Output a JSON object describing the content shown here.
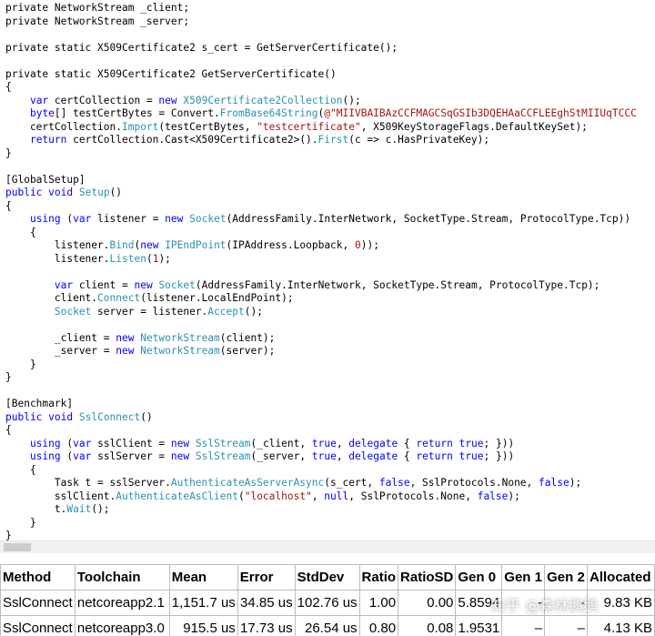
{
  "code": [
    [
      [
        "t",
        "private NetworkStream _client;"
      ]
    ],
    [
      [
        "t",
        "private NetworkStream _server;"
      ]
    ],
    [
      [
        "t",
        ""
      ]
    ],
    [
      [
        "t",
        "private static X509Certificate2 s_cert = GetServerCertificate();"
      ]
    ],
    [
      [
        "t",
        ""
      ]
    ],
    [
      [
        "t",
        "private static X509Certificate2 GetServerCertificate()"
      ]
    ],
    [
      [
        "t",
        "{"
      ]
    ],
    [
      [
        "t",
        "    "
      ],
      [
        "k",
        "var"
      ],
      [
        "t",
        " certCollection = "
      ],
      [
        "k",
        "new"
      ],
      [
        "t",
        " "
      ],
      [
        "y",
        "X509Certificate2Collection"
      ],
      [
        "t",
        "();"
      ]
    ],
    [
      [
        "t",
        "    "
      ],
      [
        "k",
        "byte"
      ],
      [
        "t",
        "[] testCertBytes = Convert."
      ],
      [
        "y",
        "FromBase64String"
      ],
      [
        "t",
        "("
      ],
      [
        "s",
        "@\"MIIVBAIBAzCCFMAGCSqGSIb3DQEHAaCCFLEEghStMIIUqTCCC"
      ]
    ],
    [
      [
        "t",
        "    certCollection."
      ],
      [
        "y",
        "Import"
      ],
      [
        "t",
        "(testCertBytes, "
      ],
      [
        "s",
        "\"testcertificate\""
      ],
      [
        "t",
        ", X509KeyStorageFlags.DefaultKeySet);"
      ]
    ],
    [
      [
        "t",
        "    "
      ],
      [
        "k",
        "return"
      ],
      [
        "t",
        " certCollection.Cast<X509Certificate2>()."
      ],
      [
        "y",
        "First"
      ],
      [
        "t",
        "(c => c.HasPrivateKey);"
      ]
    ],
    [
      [
        "t",
        "}"
      ]
    ],
    [
      [
        "t",
        ""
      ]
    ],
    [
      [
        "t",
        "[GlobalSetup]"
      ]
    ],
    [
      [
        "k",
        "public"
      ],
      [
        "t",
        " "
      ],
      [
        "k",
        "void"
      ],
      [
        "t",
        " "
      ],
      [
        "y",
        "Setup"
      ],
      [
        "t",
        "()"
      ]
    ],
    [
      [
        "t",
        "{"
      ]
    ],
    [
      [
        "t",
        "    "
      ],
      [
        "k",
        "using"
      ],
      [
        "t",
        " ("
      ],
      [
        "k",
        "var"
      ],
      [
        "t",
        " listener = "
      ],
      [
        "k",
        "new"
      ],
      [
        "t",
        " "
      ],
      [
        "y",
        "Socket"
      ],
      [
        "t",
        "(AddressFamily.InterNetwork, SocketType.Stream, ProtocolType.Tcp))"
      ]
    ],
    [
      [
        "t",
        "    {"
      ]
    ],
    [
      [
        "t",
        "        listener."
      ],
      [
        "y",
        "Bind"
      ],
      [
        "t",
        "("
      ],
      [
        "k",
        "new"
      ],
      [
        "t",
        " "
      ],
      [
        "y",
        "IPEndPoint"
      ],
      [
        "t",
        "(IPAddress.Loopback, "
      ],
      [
        "s",
        "0"
      ],
      [
        "t",
        "));"
      ]
    ],
    [
      [
        "t",
        "        listener."
      ],
      [
        "y",
        "Listen"
      ],
      [
        "t",
        "("
      ],
      [
        "s",
        "1"
      ],
      [
        "t",
        ");"
      ]
    ],
    [
      [
        "t",
        ""
      ]
    ],
    [
      [
        "t",
        "        "
      ],
      [
        "k",
        "var"
      ],
      [
        "t",
        " client = "
      ],
      [
        "k",
        "new"
      ],
      [
        "t",
        " "
      ],
      [
        "y",
        "Socket"
      ],
      [
        "t",
        "(AddressFamily.InterNetwork, SocketType.Stream, ProtocolType.Tcp);"
      ]
    ],
    [
      [
        "t",
        "        client."
      ],
      [
        "y",
        "Connect"
      ],
      [
        "t",
        "(listener.LocalEndPoint);"
      ]
    ],
    [
      [
        "t",
        "        "
      ],
      [
        "y",
        "Socket"
      ],
      [
        "t",
        " server = listener."
      ],
      [
        "y",
        "Accept"
      ],
      [
        "t",
        "();"
      ]
    ],
    [
      [
        "t",
        ""
      ]
    ],
    [
      [
        "t",
        "        _client = "
      ],
      [
        "k",
        "new"
      ],
      [
        "t",
        " "
      ],
      [
        "y",
        "NetworkStream"
      ],
      [
        "t",
        "(client);"
      ]
    ],
    [
      [
        "t",
        "        _server = "
      ],
      [
        "k",
        "new"
      ],
      [
        "t",
        " "
      ],
      [
        "y",
        "NetworkStream"
      ],
      [
        "t",
        "(server);"
      ]
    ],
    [
      [
        "t",
        "    }"
      ]
    ],
    [
      [
        "t",
        "}"
      ]
    ],
    [
      [
        "t",
        ""
      ]
    ],
    [
      [
        "t",
        "[Benchmark]"
      ]
    ],
    [
      [
        "k",
        "public"
      ],
      [
        "t",
        " "
      ],
      [
        "k",
        "void"
      ],
      [
        "t",
        " "
      ],
      [
        "y",
        "SslConnect"
      ],
      [
        "t",
        "()"
      ]
    ],
    [
      [
        "t",
        "{"
      ]
    ],
    [
      [
        "t",
        "    "
      ],
      [
        "k",
        "using"
      ],
      [
        "t",
        " ("
      ],
      [
        "k",
        "var"
      ],
      [
        "t",
        " sslClient = "
      ],
      [
        "k",
        "new"
      ],
      [
        "t",
        " "
      ],
      [
        "y",
        "SslStream"
      ],
      [
        "t",
        "(_client, "
      ],
      [
        "k",
        "true"
      ],
      [
        "t",
        ", "
      ],
      [
        "k",
        "delegate"
      ],
      [
        "t",
        " { "
      ],
      [
        "k",
        "return"
      ],
      [
        "t",
        " "
      ],
      [
        "k",
        "true"
      ],
      [
        "t",
        "; }))"
      ]
    ],
    [
      [
        "t",
        "    "
      ],
      [
        "k",
        "using"
      ],
      [
        "t",
        " ("
      ],
      [
        "k",
        "var"
      ],
      [
        "t",
        " sslServer = "
      ],
      [
        "k",
        "new"
      ],
      [
        "t",
        " "
      ],
      [
        "y",
        "SslStream"
      ],
      [
        "t",
        "(_server, "
      ],
      [
        "k",
        "true"
      ],
      [
        "t",
        ", "
      ],
      [
        "k",
        "delegate"
      ],
      [
        "t",
        " { "
      ],
      [
        "k",
        "return"
      ],
      [
        "t",
        " "
      ],
      [
        "k",
        "true"
      ],
      [
        "t",
        "; }))"
      ]
    ],
    [
      [
        "t",
        "    {"
      ]
    ],
    [
      [
        "t",
        "        Task t = sslServer."
      ],
      [
        "y",
        "AuthenticateAsServerAsync"
      ],
      [
        "t",
        "(s_cert, "
      ],
      [
        "k",
        "false"
      ],
      [
        "t",
        ", SslProtocols.None, "
      ],
      [
        "k",
        "false"
      ],
      [
        "t",
        ");"
      ]
    ],
    [
      [
        "t",
        "        sslClient."
      ],
      [
        "y",
        "AuthenticateAsClient"
      ],
      [
        "t",
        "("
      ],
      [
        "s",
        "\"localhost\""
      ],
      [
        "t",
        ", "
      ],
      [
        "k",
        "null"
      ],
      [
        "t",
        ", SslProtocols.None, "
      ],
      [
        "k",
        "false"
      ],
      [
        "t",
        ");"
      ]
    ],
    [
      [
        "t",
        "        t."
      ],
      [
        "y",
        "Wait"
      ],
      [
        "t",
        "();"
      ]
    ],
    [
      [
        "t",
        "    }"
      ]
    ],
    [
      [
        "t",
        "}"
      ]
    ]
  ],
  "table": {
    "headers": [
      "Method",
      "Toolchain",
      "Mean",
      "Error",
      "StdDev",
      "Ratio",
      "RatioSD",
      "Gen 0",
      "Gen 1",
      "Gen 2",
      "Allocated"
    ],
    "rows": [
      [
        "SslConnect",
        "netcoreapp2.1",
        "1,151.7 us",
        "34.85 us",
        "102.76 us",
        "1.00",
        "0.00",
        "5.8594",
        "-",
        "-",
        "9.83 KB"
      ],
      [
        "SslConnect",
        "netcoreapp3.0",
        "915.5 us",
        "17.73 us",
        "26.54 us",
        "0.80",
        "0.08",
        "1.9531",
        "–",
        "–",
        "4.13 KB"
      ]
    ]
  },
  "watermark": "知乎 @森林鹅鹅"
}
